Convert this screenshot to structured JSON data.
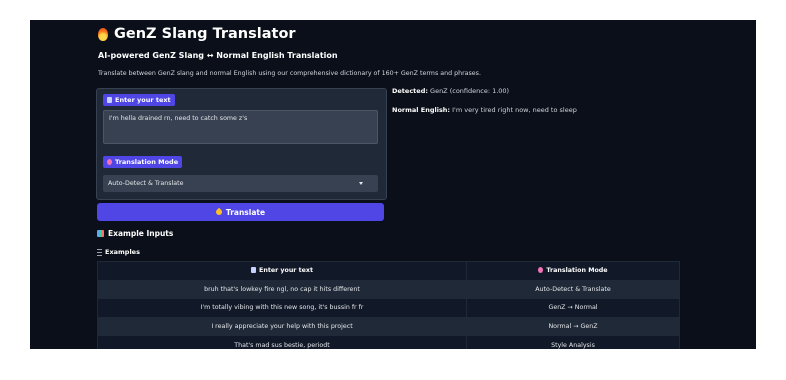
{
  "app": {
    "title": "GenZ Slang Translator",
    "subtitle": "AI-powered GenZ Slang ↔ Normal English Translation",
    "description": "Translate between GenZ slang and normal English using our comprehensive dictionary of 160+ GenZ terms and phrases."
  },
  "input": {
    "label": "Enter your text",
    "value": "I'm hella drained rn, need to catch some z's"
  },
  "mode": {
    "label": "Translation Mode",
    "selected": "Auto-Detect & Translate"
  },
  "output": {
    "detected_label": "Detected:",
    "detected_value": "GenZ (confidence: 1.00)",
    "normal_label": "Normal English:",
    "normal_value": "I'm very tired right now, need to sleep"
  },
  "translate_button": "Translate",
  "examples": {
    "heading": "Example Inputs",
    "label": "Examples",
    "columns": [
      "Enter your text",
      "Translation Mode"
    ],
    "rows": [
      [
        "bruh that's lowkey fire ngl, no cap it hits different",
        "Auto-Detect & Translate"
      ],
      [
        "I'm totally vibing with this new song, it's bussin fr fr",
        "GenZ → Normal"
      ],
      [
        "I really appreciate your help with this project",
        "Normal → GenZ"
      ],
      [
        "That's mad sus bestie, periodt",
        "Style Analysis"
      ]
    ]
  },
  "colors": {
    "background": "#0b0f19",
    "accent": "#4f46e5",
    "panel": "#1f2937"
  },
  "icons": [
    "fire-icon",
    "note-icon",
    "target-icon",
    "rocket-icon",
    "books-icon",
    "list-icon",
    "caret-down-icon"
  ]
}
